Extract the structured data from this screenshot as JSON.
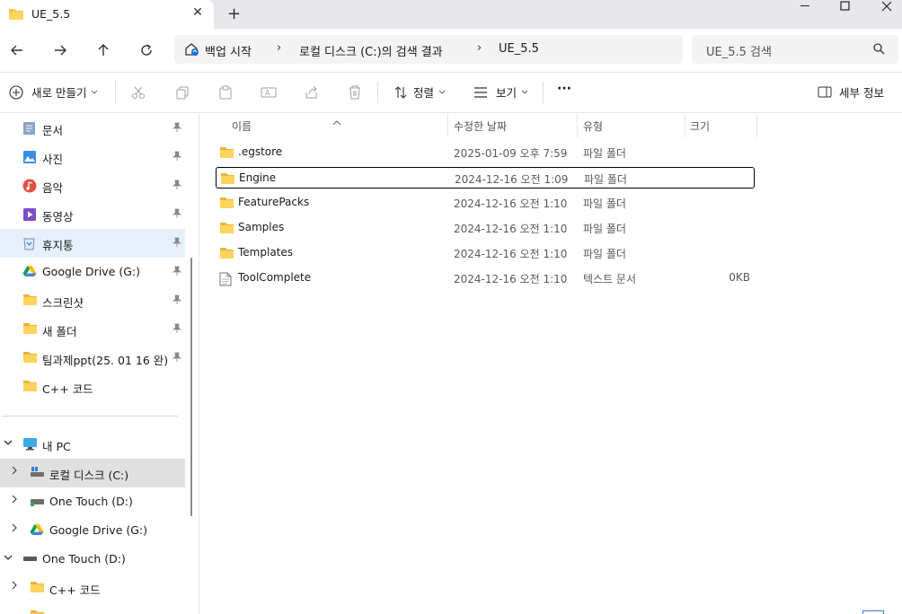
{
  "tab": {
    "title": "UE_5.5",
    "close": "✕",
    "new": "+"
  },
  "window": {
    "minimize": "—",
    "maximize": "☐",
    "close": "✕"
  },
  "address": {
    "segments": [
      "백업 시작",
      "로컬 디스크 (C:)의 검색 결과",
      "UE_5.5"
    ],
    "chevron": "›"
  },
  "search": {
    "placeholder": "UE_5.5 검색"
  },
  "toolbar": {
    "new_label": "새로 만들기",
    "sort_label": "정렬",
    "view_label": "보기",
    "more_label": "···",
    "details_label": "세부 정보"
  },
  "nav": {
    "quick": [
      {
        "label": "문서",
        "icon": "document-icon",
        "pinned": true
      },
      {
        "label": "사진",
        "icon": "pictures-icon",
        "pinned": true
      },
      {
        "label": "음악",
        "icon": "music-icon",
        "pinned": true
      },
      {
        "label": "동영상",
        "icon": "video-icon",
        "pinned": true
      },
      {
        "label": "휴지통",
        "icon": "recycle-bin-icon",
        "pinned": true,
        "selected": true
      },
      {
        "label": "Google Drive (G:)",
        "icon": "google-drive-icon",
        "pinned": true
      },
      {
        "label": "스크린샷",
        "icon": "folder-icon",
        "pinned": true
      },
      {
        "label": "새 폴더",
        "icon": "folder-icon",
        "pinned": true
      },
      {
        "label": "팀과제ppt(25. 01 16 완)",
        "icon": "folder-icon",
        "pinned": true
      },
      {
        "label": "C++ 코드",
        "icon": "folder-icon",
        "pinned": false
      }
    ],
    "tree": [
      {
        "label": "내 PC",
        "icon": "pc-icon",
        "expanded": true
      },
      {
        "label": "로컬 디스크 (C:)",
        "icon": "drive-icon",
        "expanded": false,
        "hover": true
      },
      {
        "label": "One Touch (D:)",
        "icon": "external-drive-icon",
        "expanded": false
      },
      {
        "label": "Google Drive (G:)",
        "icon": "google-drive-icon",
        "expanded": false
      },
      {
        "label": "One Touch (D:)",
        "icon": "external-drive-icon",
        "expanded": true
      },
      {
        "label": "C++ 코드",
        "icon": "folder-icon",
        "expanded": false
      }
    ]
  },
  "columns": {
    "name": "이름",
    "date": "수정한 날짜",
    "type": "유형",
    "size": "크기"
  },
  "files": [
    {
      "name": ".egstore",
      "date": "2025-01-09 오후 7:59",
      "type": "파일 폴더",
      "size": "",
      "icon": "folder-icon"
    },
    {
      "name": "Engine",
      "date": "2024-12-16 오전 1:09",
      "type": "파일 폴더",
      "size": "",
      "icon": "folder-icon",
      "focused": true
    },
    {
      "name": "FeaturePacks",
      "date": "2024-12-16 오전 1:10",
      "type": "파일 폴더",
      "size": "",
      "icon": "folder-icon"
    },
    {
      "name": "Samples",
      "date": "2024-12-16 오전 1:10",
      "type": "파일 폴더",
      "size": "",
      "icon": "folder-icon"
    },
    {
      "name": "Templates",
      "date": "2024-12-16 오전 1:10",
      "type": "파일 폴더",
      "size": "",
      "icon": "folder-icon"
    },
    {
      "name": "ToolComplete",
      "date": "2024-12-16 오전 1:10",
      "type": "텍스트 문서",
      "size": "0KB",
      "icon": "text-file-icon"
    }
  ],
  "colors": {
    "folder": "#f6c443",
    "selected_bg": "#e5f0fb",
    "accent": "#0067c0"
  }
}
